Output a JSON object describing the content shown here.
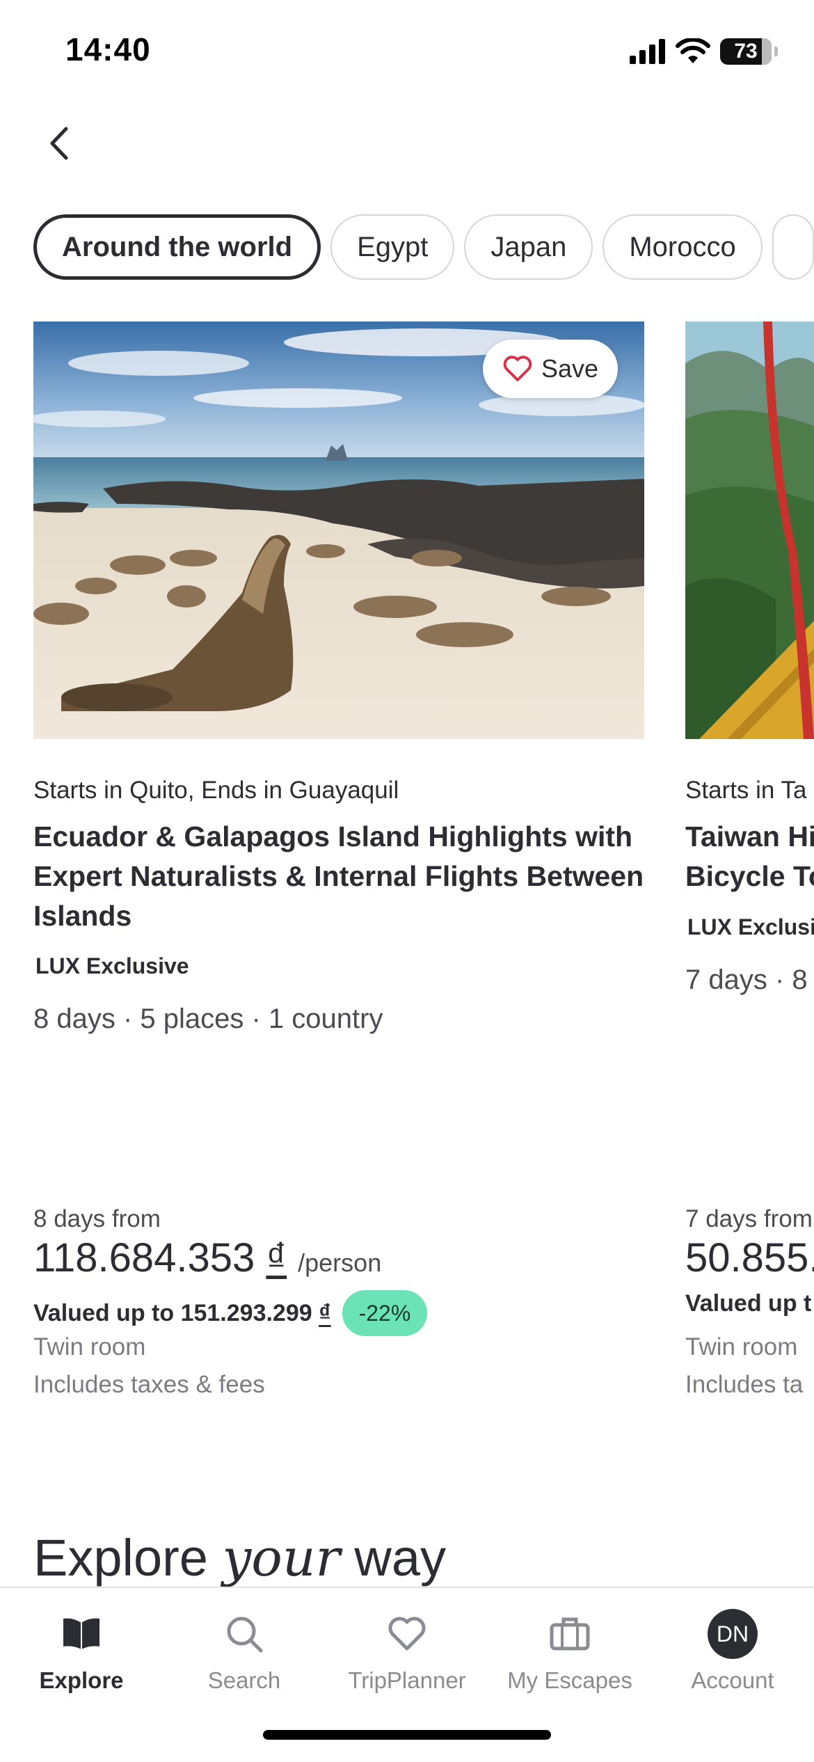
{
  "status_bar": {
    "time": "14:40",
    "battery": "73"
  },
  "nav": {
    "back_icon": "chevron-left-icon"
  },
  "chips": [
    {
      "label": "Around the world",
      "active": true
    },
    {
      "label": "Egypt"
    },
    {
      "label": "Japan"
    },
    {
      "label": "Morocco"
    }
  ],
  "cards": [
    {
      "save_label": "Save",
      "starts": "Starts in Quito, Ends in Guayaquil",
      "title": "Ecuador & Galapagos Island Highlights with Expert Naturalists & Internal Flights Between Islands",
      "badge": "LUX Exclusive",
      "summary": "8 days · 5 places · 1 country",
      "from": "8 days from",
      "price": "118.684.353",
      "currency": "₫",
      "per": "/person",
      "valued": "Valued up to 151.293.299",
      "discount": "-22%",
      "room": "Twin room",
      "taxes": "Includes taxes & fees"
    },
    {
      "starts": "Starts in Ta",
      "title_line1": "Taiwan Hi",
      "title_line2": "Bicycle To",
      "badge": "LUX Exclusi",
      "summary": "7 days · 8",
      "from": "7 days from",
      "price": "50.855.",
      "valued": "Valued up t",
      "room": "Twin room",
      "taxes": "Includes ta"
    }
  ],
  "explore": {
    "prefix": "Explore",
    "italic": "your",
    "suffix": "way"
  },
  "bottom_nav": [
    {
      "label": "Explore",
      "icon": "book-icon",
      "active": true
    },
    {
      "label": "Search",
      "icon": "search-icon"
    },
    {
      "label": "TripPlanner",
      "icon": "heart-icon"
    },
    {
      "label": "My Escapes",
      "icon": "suitcase-icon"
    },
    {
      "label": "Account",
      "icon": "avatar",
      "initials": "DN"
    }
  ],
  "colors": {
    "text": "#2b2d33",
    "discount_badge": "#6be3b7",
    "heart": "#d6334a"
  }
}
